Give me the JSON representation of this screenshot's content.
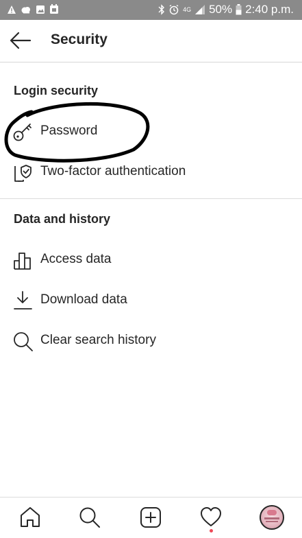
{
  "status_bar": {
    "battery_percent": "50%",
    "time": "2:40 p.m.",
    "network_label": "4G",
    "left_icons": [
      "warning-icon",
      "cloud-icon",
      "image-icon",
      "calendar-icon"
    ],
    "right_icons": [
      "bluetooth-icon",
      "alarm-icon",
      "signal-icon",
      "battery-icon"
    ]
  },
  "header": {
    "title": "Security",
    "back_icon": "arrow-left-icon"
  },
  "sections": {
    "login_security": {
      "title": "Login security",
      "items": [
        {
          "label": "Password",
          "icon": "key-icon"
        },
        {
          "label": "Two-factor authentication",
          "icon": "shield-phone-icon"
        }
      ]
    },
    "data_history": {
      "title": "Data and history",
      "items": [
        {
          "label": "Access data",
          "icon": "bar-chart-icon"
        },
        {
          "label": "Download data",
          "icon": "download-icon"
        },
        {
          "label": "Clear search history",
          "icon": "search-icon"
        }
      ]
    }
  },
  "bottom_nav": {
    "items": [
      "home-icon",
      "search-icon",
      "add-post-icon",
      "activity-heart-icon",
      "profile-avatar"
    ],
    "notification_color": "#ed4956"
  },
  "colors": {
    "status_bar": "#8a8a8a",
    "text": "#262626",
    "divider": "#dbdbdb",
    "annotation": "#000000"
  }
}
